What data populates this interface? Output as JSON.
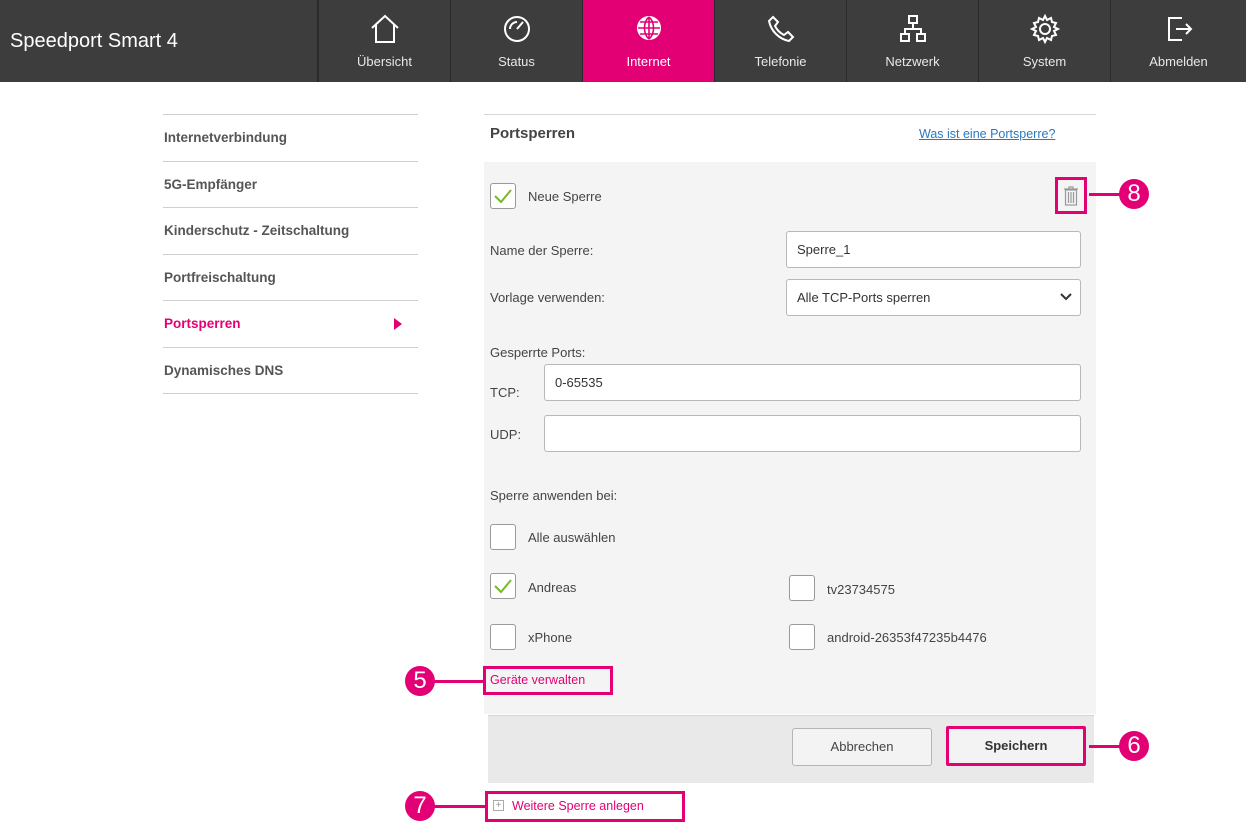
{
  "app": {
    "title": "Speedport Smart 4"
  },
  "nav": [
    {
      "label": "Übersicht",
      "icon": "home-icon"
    },
    {
      "label": "Status",
      "icon": "gauge-icon"
    },
    {
      "label": "Internet",
      "icon": "globe-icon",
      "active": true
    },
    {
      "label": "Telefonie",
      "icon": "phone-icon"
    },
    {
      "label": "Netzwerk",
      "icon": "network-icon"
    },
    {
      "label": "System",
      "icon": "gear-icon"
    },
    {
      "label": "Abmelden",
      "icon": "logout-icon"
    }
  ],
  "sidebar": {
    "items": [
      {
        "label": "Internetverbindung"
      },
      {
        "label": "5G-Empfänger"
      },
      {
        "label": "Kinderschutz - Zeitschaltung"
      },
      {
        "label": "Portfreischaltung"
      },
      {
        "label": "Portsperren",
        "active": true
      },
      {
        "label": "Dynamisches DNS"
      }
    ]
  },
  "main": {
    "title": "Portsperren",
    "help_link": "Was ist eine Portsperre?",
    "rule": {
      "enabled_label": "Neue Sperre",
      "enabled": true,
      "name_label": "Name der Sperre:",
      "name_value": "Sperre_1",
      "template_label": "Vorlage verwenden:",
      "template_value": "Alle TCP-Ports sperren",
      "ports_heading": "Gesperrte Ports:",
      "tcp_label": "TCP:",
      "tcp_value": "0-65535",
      "udp_label": "UDP:",
      "udp_value": "",
      "apply_heading": "Sperre anwenden bei:",
      "select_all_label": "Alle auswählen",
      "devices": [
        {
          "label": "Andreas",
          "checked": true
        },
        {
          "label": "tv23734575",
          "checked": false
        },
        {
          "label": "xPhone",
          "checked": false
        },
        {
          "label": "android-26353f47235b4476",
          "checked": false
        }
      ],
      "manage_devices_link": "Geräte verwalten"
    },
    "cancel_button": "Abbrechen",
    "save_button": "Speichern",
    "add_rule_link": "Weitere Sperre anlegen"
  },
  "callouts": {
    "manage_devices": "5",
    "save": "6",
    "add_rule": "7",
    "delete": "8"
  },
  "colors": {
    "accent": "#e20074",
    "topbar": "#3d3d3d",
    "check": "#7ab829",
    "link": "#2a78c2"
  }
}
